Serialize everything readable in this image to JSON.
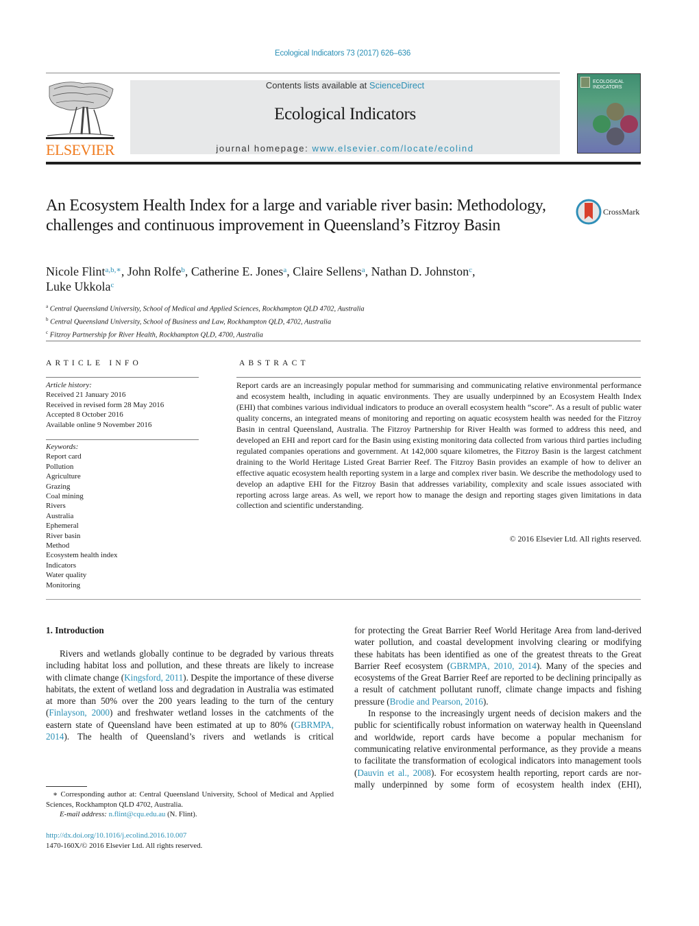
{
  "header": {
    "journal_reference": "Ecological Indicators 73 (2017) 626–636",
    "contents_prefix": "Contents lists available at ",
    "contents_link": "ScienceDirect",
    "journal_name": "Ecological Indicators",
    "homepage_prefix": "journal homepage: ",
    "homepage_link": "www.elsevier.com/locate/ecolind",
    "publisher_logo": "ELSEVIER",
    "cover_title_line1": "ECOLOGICAL",
    "cover_title_line2": "INDICATORS",
    "crossmark_label": "CrossMark"
  },
  "article": {
    "title": "An Ecosystem Health Index for a large and variable river basin: Methodology, challenges and continuous improvement in Queensland’s Fitzroy Basin",
    "authors": [
      {
        "name": "Nicole Flint",
        "sup": "a,b,∗",
        "sep": ", "
      },
      {
        "name": "John Rolfe",
        "sup": "b",
        "sep": ", "
      },
      {
        "name": "Catherine E. Jones",
        "sup": "a",
        "sep": ", "
      },
      {
        "name": "Claire Sellens",
        "sup": "a",
        "sep": ", "
      },
      {
        "name": "Nathan D. Johnston",
        "sup": "c",
        "sep": ","
      },
      {
        "name": "Luke Ukkola",
        "sup": "c",
        "sep": ""
      }
    ],
    "affiliations": [
      {
        "key": "a",
        "text": "Central Queensland University, School of Medical and Applied Sciences, Rockhampton QLD 4702, Australia"
      },
      {
        "key": "b",
        "text": "Central Queensland University, School of Business and Law, Rockhampton QLD, 4702, Australia"
      },
      {
        "key": "c",
        "text": "Fitzroy Partnership for River Health, Rockhampton QLD, 4700, Australia"
      }
    ]
  },
  "article_info": {
    "heading": "ARTICLE INFO",
    "history_label": "Article history:",
    "history": [
      "Received 21 January 2016",
      "Received in revised form 28 May 2016",
      "Accepted 8 October 2016",
      "Available online 9 November 2016"
    ],
    "keywords_label": "Keywords:",
    "keywords": [
      "Report card",
      "Pollution",
      "Agriculture",
      "Grazing",
      "Coal mining",
      "Rivers",
      "Australia",
      "Ephemeral",
      "River basin",
      "Method",
      "Ecosystem health index",
      "Indicators",
      "Water quality",
      "Monitoring"
    ]
  },
  "abstract": {
    "heading": "ABSTRACT",
    "text": "Report cards are an increasingly popular method for summarising and communicating relative envi­ronmental performance and ecosystem health, including in aquatic environments. They are usually underpinned by an Ecosystem Health Index (EHI) that combines various individual indicators to pro­duce an overall ecosystem health “score”. As a result of public water quality concerns, an integrated means of monitoring and reporting on aquatic ecosystem health was needed for the Fitzroy Basin in central Queensland, Australia. The Fitzroy Partnership for River Health was formed to address this need, and developed an EHI and report card for the Basin using existing monitoring data collected from various third parties including regulated companies operations and government. At 142,000 square kilometres, the Fitzroy Basin is the largest catchment draining to the World Heritage Listed Great Barrier Reef. The Fitzroy Basin provides an example of how to deliver an effective aquatic ecosystem health reporting sys­tem in a large and complex river basin. We describe the methodology used to develop an adaptive EHI for the Fitzroy Basin that addresses variability, complexity and scale issues associated with reporting across large areas. As well, we report how to manage the design and reporting stages given limitations in data collection and scientific understanding.",
    "copyright": "© 2016 Elsevier Ltd. All rights reserved."
  },
  "body": {
    "section_heading": "1.  Introduction",
    "p1": [
      {
        "t": "Rivers and wetlands globally continue to be degraded by various threats including habitat loss and pollution, and these threats are likely to increase with climate change ("
      },
      {
        "link": "Kingsford, 2011"
      },
      {
        "t": "). Despite the importance of these diverse habitats, the extent of wetland loss and degradation in Australia was estimated at more than 50% over the 200 years leading to the turn of the century ("
      },
      {
        "link": "Finlayson, 2000"
      },
      {
        "t": ") and freshwater wetland losses in the catchments of the eastern state of Queensland have been estimated at up to 80% ("
      },
      {
        "link": "GBRMPA, 2014"
      },
      {
        "t": "). The health of Queensland’s rivers and wetlands is critical for protecting the Great Barrier Reef World Heritage Area from land-derived water pollution, and coastal development involving clearing or modifying these habitats has been identified as one of the greatest threats to the Great Barrier Reef ecosystem ("
      },
      {
        "link": "GBRMPA, 2010, 2014"
      },
      {
        "t": "). Many of the species and ecosystems of the Great Bar­rier Reef are reported to be declining principally as a result of catchment pollutant runoff, climate change impacts and fishing pressure ("
      },
      {
        "link": "Brodie and Pearson, 2016"
      },
      {
        "t": ")."
      }
    ],
    "p2": [
      {
        "t": "In response to the increasingly urgent needs of decision makers and the public for scientifically robust information on waterway health in Queensland and worldwide, report cards have become a popular mechanism for communicating relative environmental performance, as they provide a means to facilitate the transfor­mation of ecological indicators into management tools ("
      },
      {
        "link": "Dauvin et al., 2008"
      },
      {
        "t": "). For ecosystem health reporting, report cards are nor­mally underpinned by some form of ecosystem health index (EHI),"
      }
    ]
  },
  "footnote": {
    "marker": "∗",
    "corresponding": "Corresponding author at: Central Queensland University, School of Medical and Applied Sciences, Rockhampton QLD 4702, Australia.",
    "email_label": "E-mail address: ",
    "email": "n.flint@cqu.edu.au",
    "email_suffix": " (N. Flint).",
    "doi": "http://dx.doi.org/10.1016/j.ecolind.2016.10.007",
    "issn_copyright": "1470-160X/© 2016 Elsevier Ltd. All rights reserved."
  },
  "colors": {
    "link": "#2a8fb5",
    "elsevier_orange": "#f07b1e",
    "header_box": "#e7e8e9"
  }
}
